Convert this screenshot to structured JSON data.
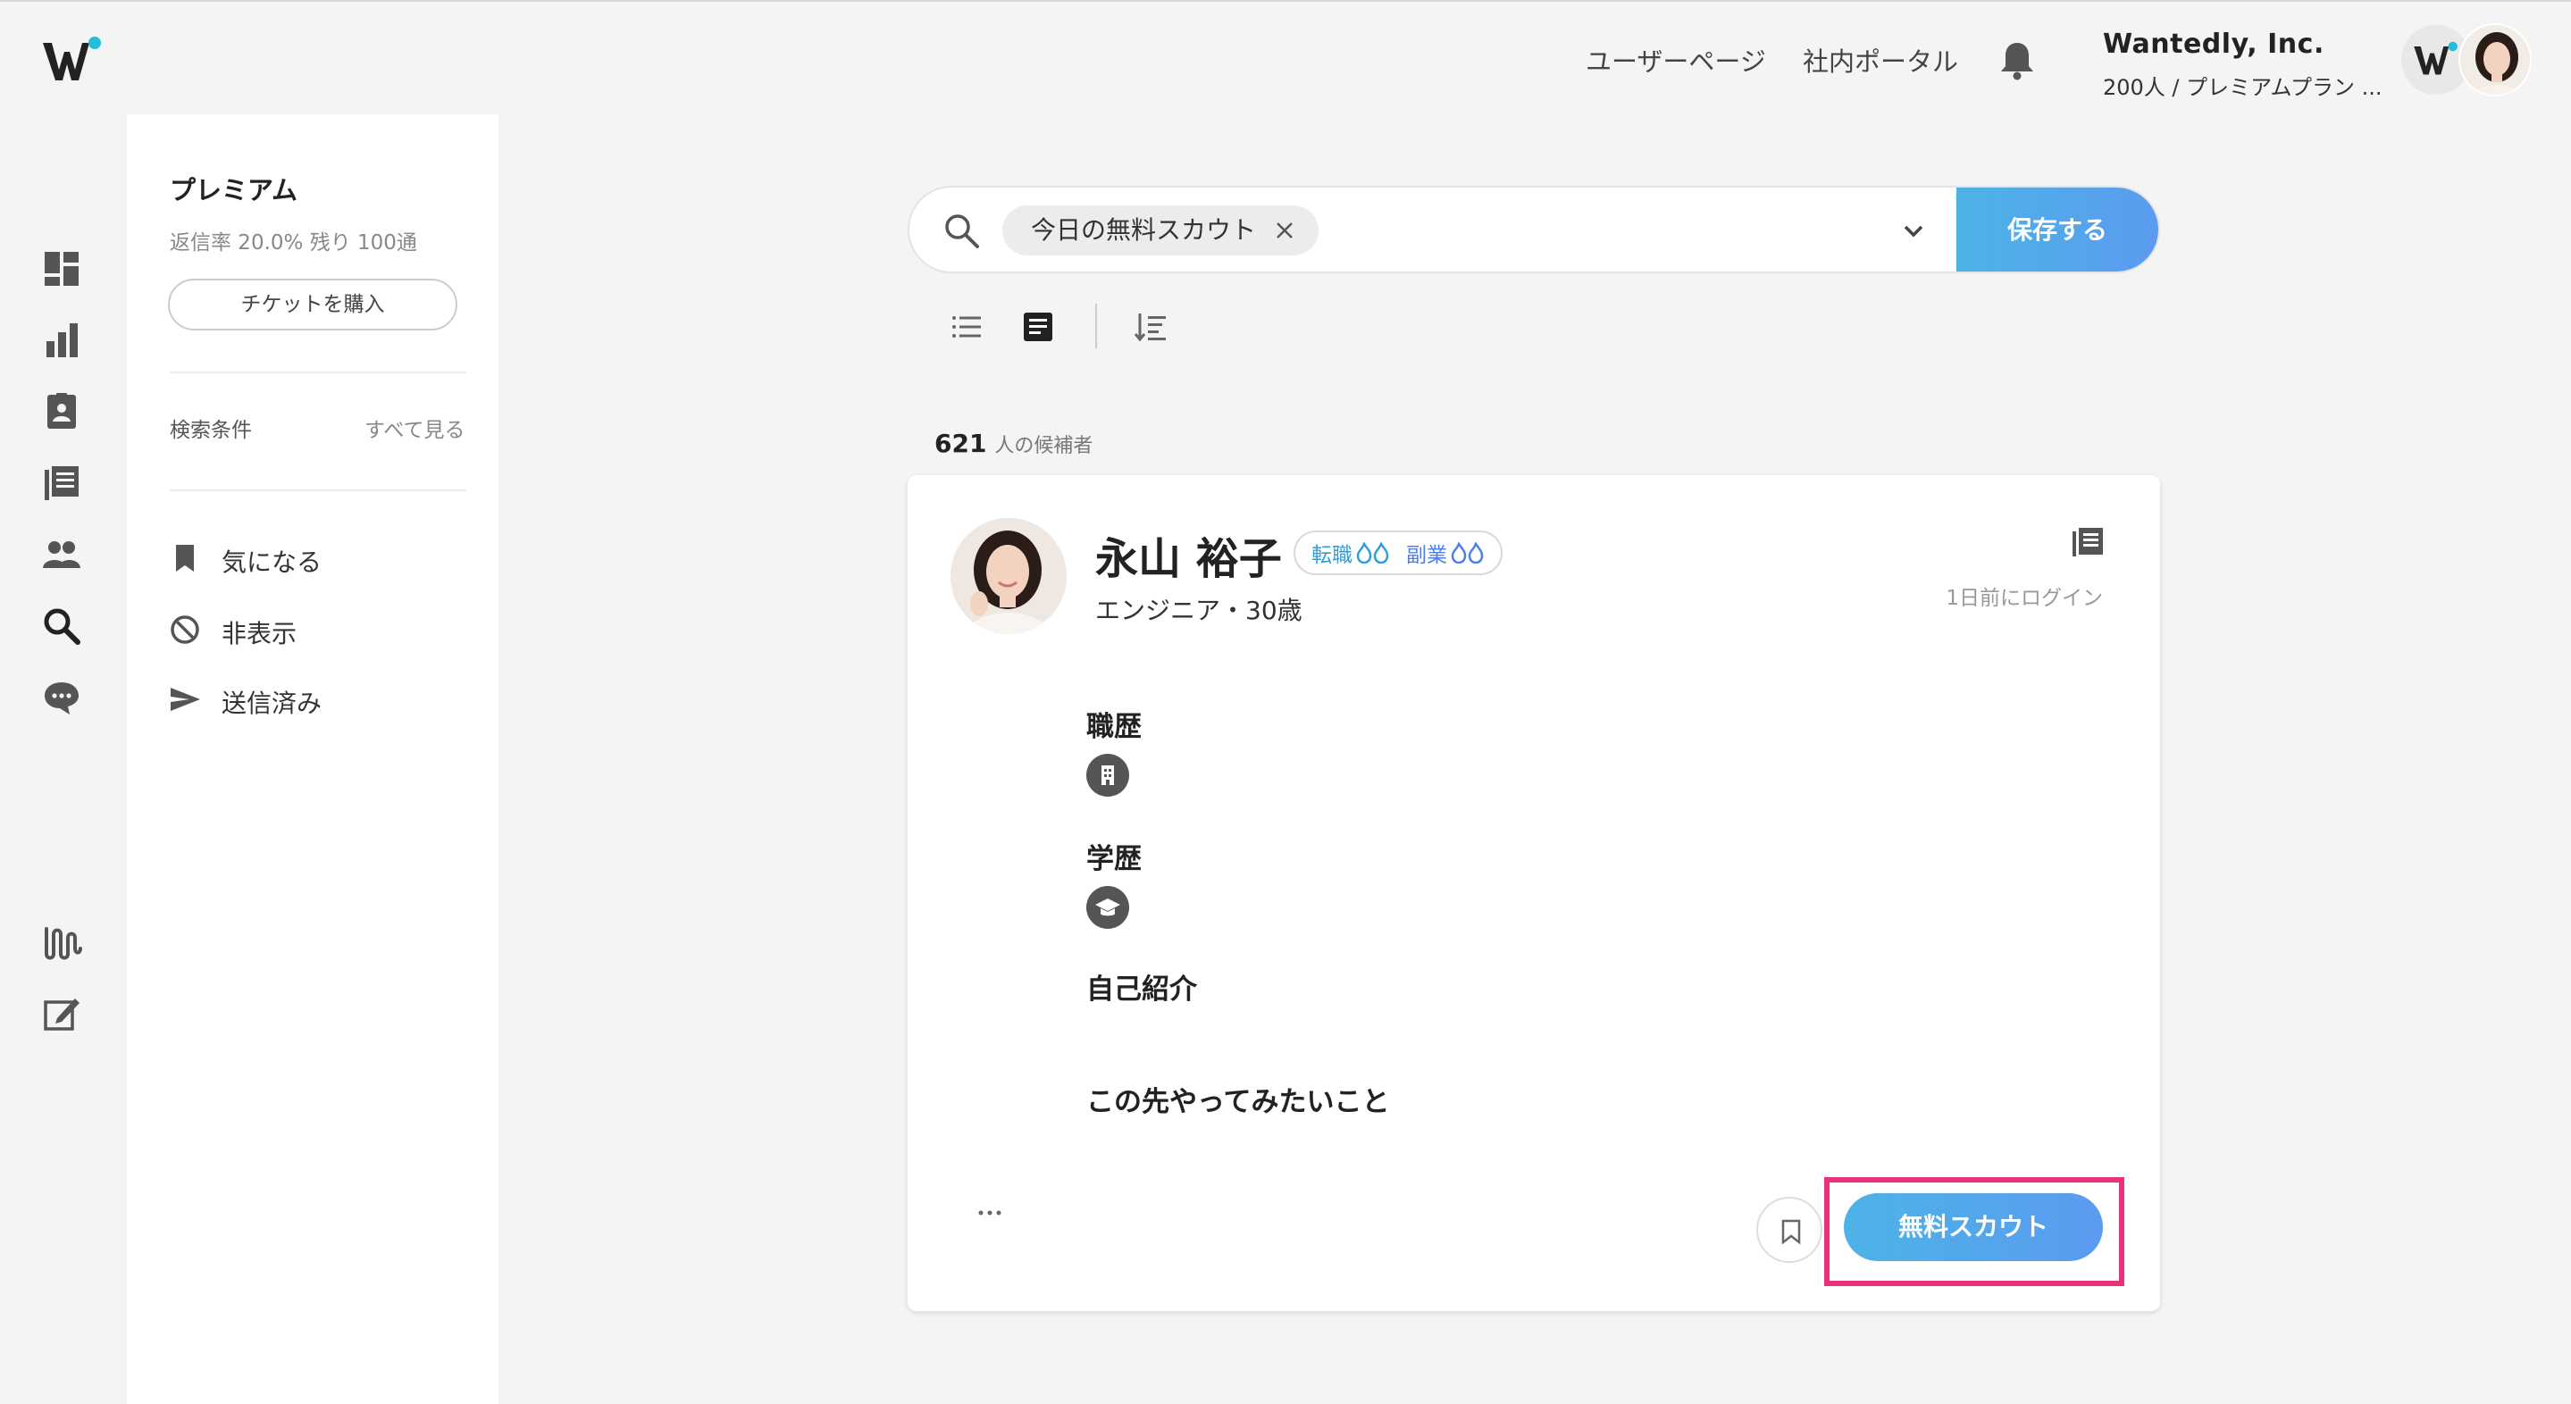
{
  "header": {
    "nav_user_page": "ユーザーページ",
    "nav_portal": "社内ポータル",
    "company_name": "Wantedly, Inc.",
    "company_plan": "200人 / プレミアムプラン ..."
  },
  "rail": {
    "icons": [
      "dashboard-icon",
      "analytics-icon",
      "profile-icon",
      "articles-icon",
      "people-icon",
      "search-icon",
      "chat-icon",
      "wantedly-icon",
      "edit-icon"
    ]
  },
  "left_panel": {
    "title": "プレミアム",
    "reply_rate": "返信率 20.0%  残り 100通",
    "buy_ticket": "チケットを購入",
    "conditions": "検索条件",
    "see_all": "すべて見る",
    "items": [
      {
        "label": "気になる",
        "icon": "bookmark-icon"
      },
      {
        "label": "非表示",
        "icon": "hidden-icon"
      },
      {
        "label": "送信済み",
        "icon": "send-icon"
      }
    ]
  },
  "search": {
    "chip": "今日の無料スカウト",
    "save": "保存する"
  },
  "results": {
    "count": "621",
    "suffix": "人の候補者"
  },
  "candidate": {
    "name": "永山 裕子",
    "badge_job": "転職",
    "badge_side": "副業",
    "role": "エンジニア・30歳",
    "last_login": "1日前にログイン",
    "sec_career": "職歴",
    "sec_education": "学歴",
    "sec_intro": "自己紹介",
    "sec_future": "この先やってみたいこと",
    "more": "...",
    "scout_button": "無料スカウト"
  },
  "colors": {
    "accent_start": "#4db3e6",
    "accent_end": "#5a9bf0",
    "highlight": "#e8337a",
    "badge_text": "#2f9fd8"
  }
}
